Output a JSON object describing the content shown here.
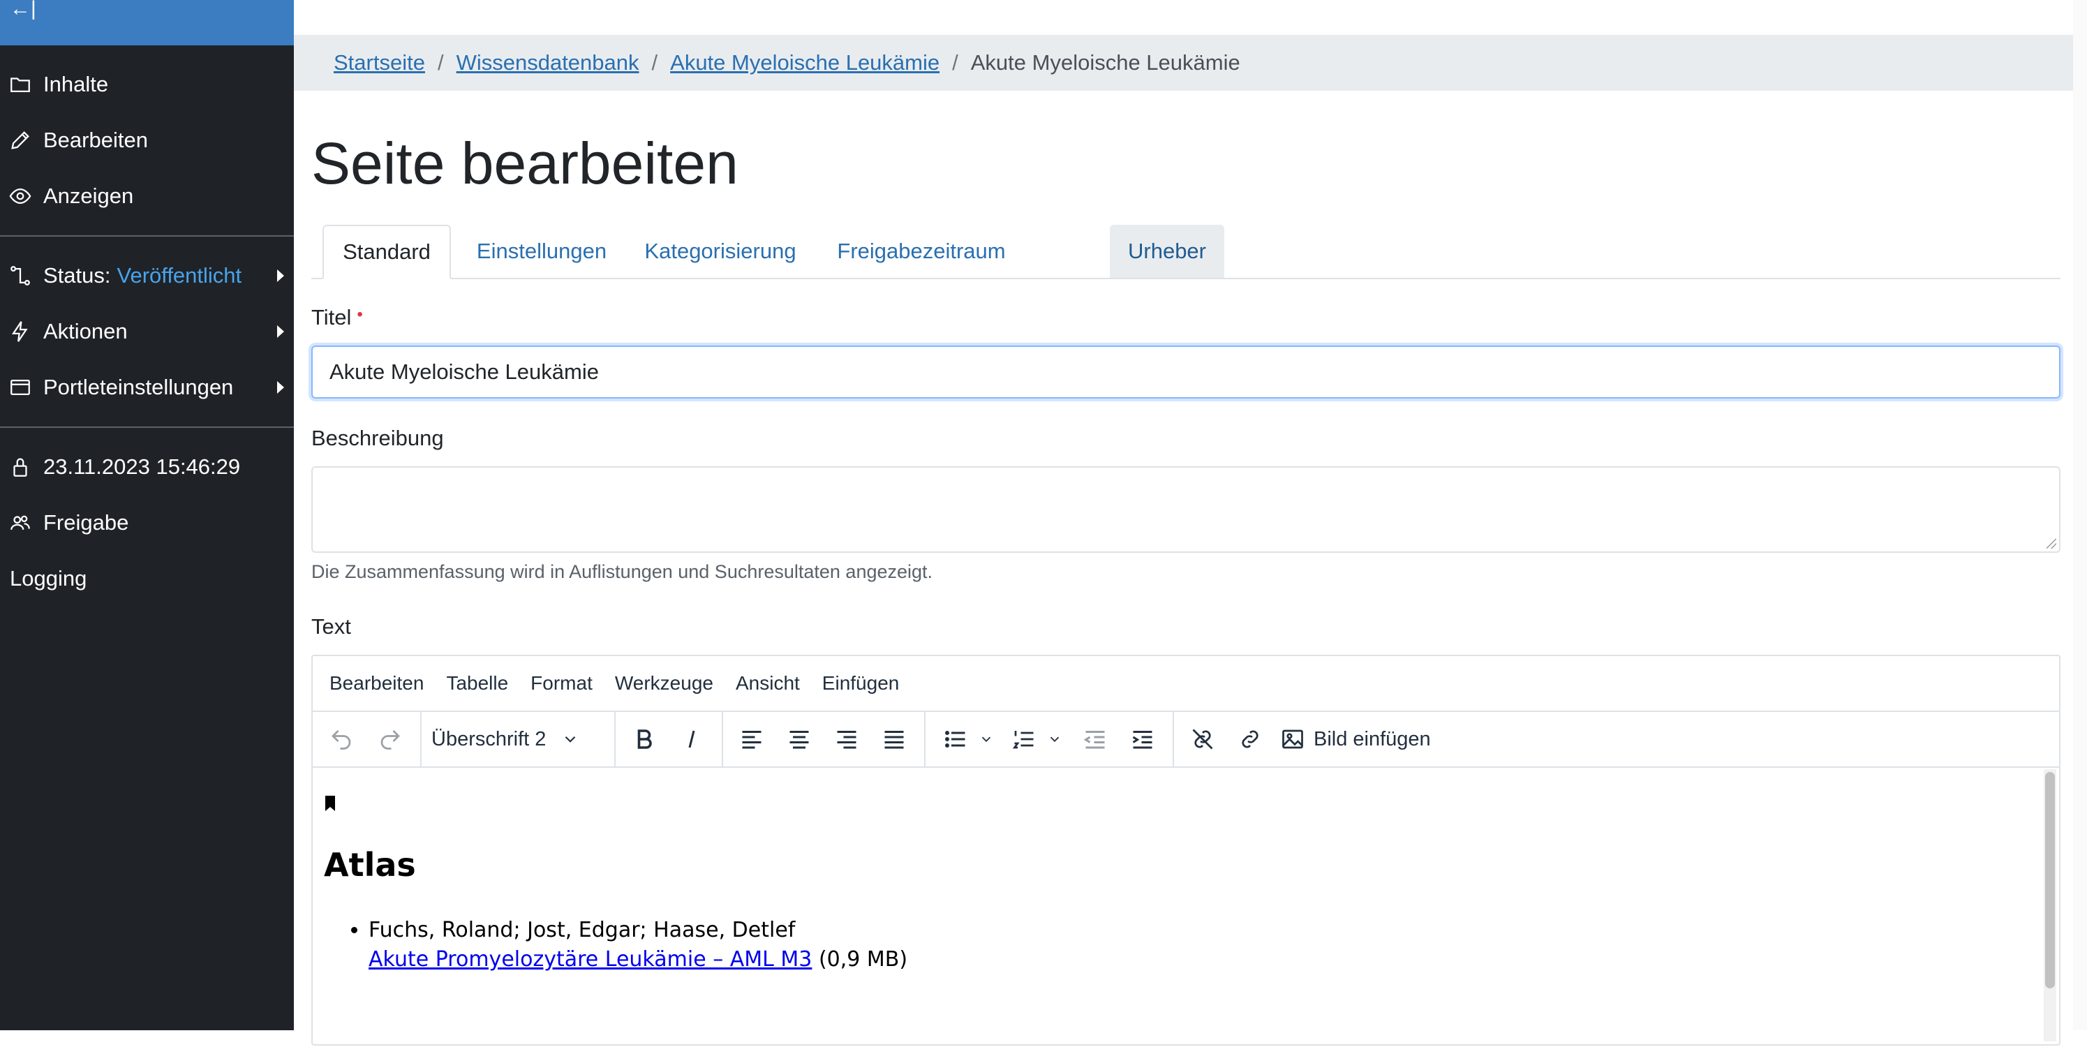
{
  "sidebar": {
    "collapse_label": "←|",
    "items": [
      {
        "icon": "folder-icon",
        "label": "Inhalte"
      },
      {
        "icon": "pencil-icon",
        "label": "Bearbeiten"
      },
      {
        "icon": "eye-icon",
        "label": "Anzeigen"
      },
      {
        "icon": "workflow-icon",
        "label": "Status:",
        "value": "Veröffentlicht"
      },
      {
        "icon": "lightning-icon",
        "label": "Aktionen"
      },
      {
        "icon": "portlet-icon",
        "label": "Portleteinstellungen"
      },
      {
        "icon": "lock-icon",
        "label": "23.11.2023 15:46:29"
      },
      {
        "icon": "users-icon",
        "label": "Freigabe"
      },
      {
        "label": "Logging"
      }
    ]
  },
  "breadcrumb": {
    "links": [
      "Startseite",
      "Wissensdatenbank",
      "Akute Myeloische Leukämie"
    ],
    "separator": "/",
    "current": "Akute Myeloische Leukämie"
  },
  "page_title": "Seite bearbeiten",
  "tabs": [
    "Standard",
    "Einstellungen",
    "Kategorisierung",
    "Freigabezeitraum",
    "Urheber"
  ],
  "form": {
    "title_label": "Titel",
    "required_marker": "•",
    "title_value": "Akute Myeloische Leukämie",
    "description_label": "Beschreibung",
    "description_value": "",
    "description_help": "Die Zusammenfassung wird in Auflistungen und Suchresultaten angezeigt.",
    "text_label": "Text"
  },
  "editor": {
    "menus": [
      "Bearbeiten",
      "Tabelle",
      "Format",
      "Werkzeuge",
      "Ansicht",
      "Einfügen"
    ],
    "block_format": "Überschrift 2",
    "insert_image_label": "Bild einfügen",
    "content": {
      "heading": "Atlas",
      "list_items": [
        {
          "authors": "Fuchs, Roland; Jost, Edgar; Haase, Detlef",
          "link_text": "Akute Promyelozytäre Leukämie – AML M3",
          "size": "(0,9 MB)"
        }
      ]
    }
  },
  "colors": {
    "sidebar_bg": "#1f2328",
    "sidebar_top": "#3b7dc0",
    "accent": "#4aa3ea",
    "link": "#2a6fb0"
  }
}
